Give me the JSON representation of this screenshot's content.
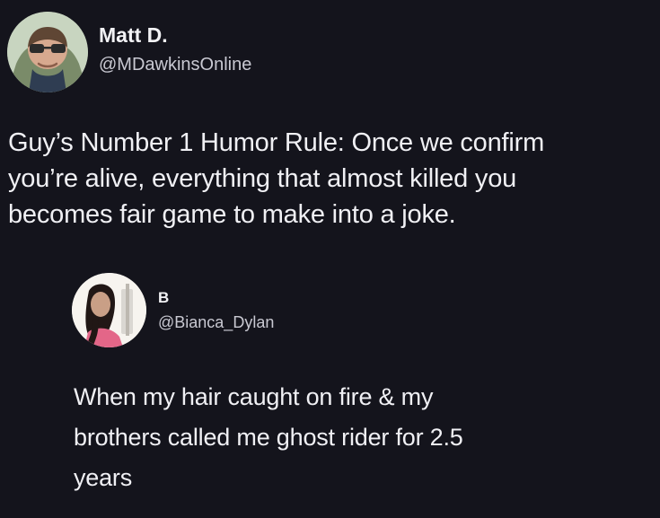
{
  "main_tweet": {
    "display_name": "Matt D.",
    "handle": "@MDawkinsOnline",
    "text": "Guy’s Number 1 Humor Rule: Once we confirm\nyou’re alive, everything that almost killed you\nbecomes fair game to make into a joke.",
    "avatar_icon": "man-with-sunglasses-avatar"
  },
  "reply_tweet": {
    "display_name": "B",
    "handle": "@Bianca_Dylan",
    "text": "When my hair caught on fire & my\nbrothers called me ghost rider for 2.5\nyears",
    "avatar_icon": "woman-with-dark-hair-avatar"
  },
  "colors": {
    "background": "#14141c",
    "text_primary": "#f0f0f4",
    "text_secondary": "#c9c9d2"
  }
}
